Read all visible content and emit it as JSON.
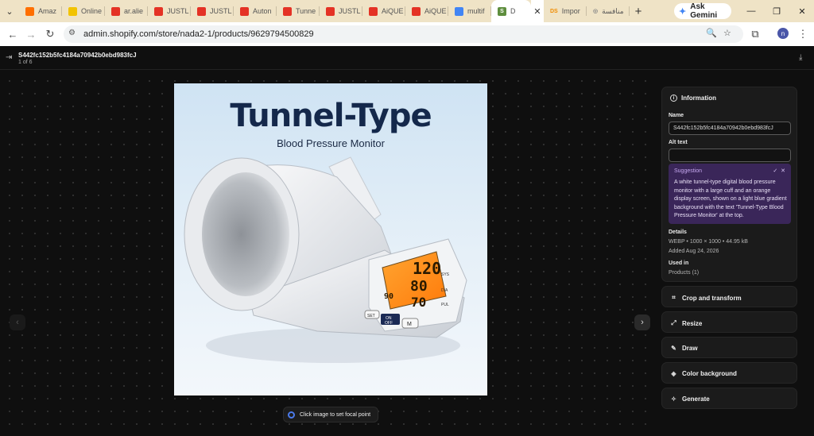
{
  "browser": {
    "tabs": [
      {
        "label": "Amaz",
        "icon": "amazon-icon",
        "color": "#ff6f00"
      },
      {
        "label": "Online",
        "icon": "smiley-icon",
        "color": "#f2c300"
      },
      {
        "label": "ar.alie",
        "icon": "aliexpress-icon",
        "color": "#e43225"
      },
      {
        "label": "JUSTL",
        "icon": "aliexpress-icon",
        "color": "#e43225"
      },
      {
        "label": "JUSTL",
        "icon": "aliexpress-icon",
        "color": "#e43225"
      },
      {
        "label": "Auton",
        "icon": "aliexpress-icon",
        "color": "#e43225"
      },
      {
        "label": "Tunne",
        "icon": "aliexpress-icon",
        "color": "#e43225"
      },
      {
        "label": "JUSTL",
        "icon": "aliexpress-icon",
        "color": "#e43225"
      },
      {
        "label": "AiQUE",
        "icon": "aliexpress-icon",
        "color": "#e43225"
      },
      {
        "label": "AiQUE",
        "icon": "aliexpress-icon",
        "color": "#e43225"
      },
      {
        "label": "multif",
        "icon": "google-icon",
        "color": "#4285f4"
      }
    ],
    "active_tab": {
      "label": "D",
      "icon": "shopify-icon",
      "color": "#5e8e3e"
    },
    "after_tabs": [
      {
        "label": "Impor",
        "icon": "ds-icon",
        "color": "#f08c00",
        "glyph": "DS"
      },
      {
        "label": "منافسة",
        "icon": "globe-icon",
        "color": "#888888",
        "glyph": "◎"
      }
    ],
    "gemini_label": "Ask Gemini",
    "url": "admin.shopify.com/store/nada2-1/products/9629794500829",
    "profile_initial": "n"
  },
  "viewer": {
    "file_name": "S442fc152b5fc4184a70942b0ebd983fcJ",
    "position": "1 of 6",
    "focal_hint": "Click image to set focal point"
  },
  "image": {
    "headline": "Tunnel-Type",
    "subheadline": "Blood Pressure Monitor",
    "display": {
      "sys": "120",
      "dia": "80",
      "pul": "70",
      "time": "90",
      "sys_label": "SYS",
      "dia_label": "DIA",
      "pul_label": "PUL"
    },
    "buttons": {
      "set": "SET",
      "on": "ON",
      "off": "OFF",
      "m": "M"
    }
  },
  "panel": {
    "info_title": "Information",
    "name_label": "Name",
    "name_value": "S442fc152b5fc4184a70942b0ebd983fcJ",
    "alt_label": "Alt text",
    "alt_value": "",
    "suggestion_title": "Suggestion",
    "suggestion_text": "A white tunnel-type digital blood pressure monitor with a large cuff and an orange display screen, shown on a light blue gradient background with the text 'Tunnel-Type Blood Pressure Monitor' at the top.",
    "details_label": "Details",
    "details_value": "WEBP • 1000 × 1000 • 44.95 kB",
    "added_value": "Added Aug 24, 2026",
    "used_in_label": "Used in",
    "used_in_value": "Products (1)",
    "actions": [
      {
        "label": "Crop and transform",
        "icon": "crop-icon"
      },
      {
        "label": "Resize",
        "icon": "resize-icon"
      },
      {
        "label": "Draw",
        "icon": "draw-icon"
      },
      {
        "label": "Color background",
        "icon": "color-background-icon"
      },
      {
        "label": "Generate",
        "icon": "generate-icon"
      }
    ]
  }
}
